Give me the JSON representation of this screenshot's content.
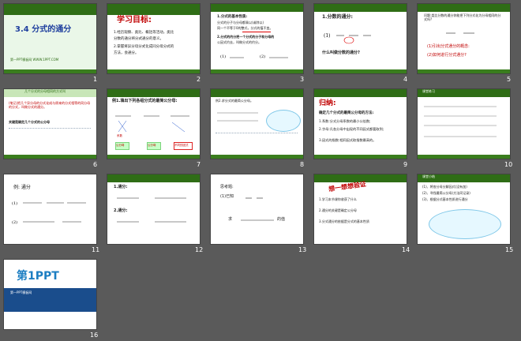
{
  "slides": [
    {
      "num": "1",
      "title": "3.4 分式的通分",
      "footer": "第一PPT模板网 WWW.1PPT.COM"
    },
    {
      "num": "2",
      "title": "学习目标:",
      "lines": [
        "1.经历观察、类比、概括等活动，类比",
        "分数的通分将分式通分的意义。",
        "2.掌握将异分母分式化成同分母分式的",
        "方法，会通分。"
      ]
    },
    {
      "num": "3",
      "lines": [
        "1.分式的基本性质:",
        "分式的分子与分母都乘以(或除以)",
        "同一个不等于0的整式，分式的值不变。",
        "2.分式的约分把一个分式的分子和分母的",
        "公因式约去，叫做分式的约分。"
      ]
    },
    {
      "num": "4",
      "heading": "1.分数的通分:",
      "question": "什么叫做分数的通分?"
    },
    {
      "num": "5",
      "question": "问题:类比分数的通分你能把下列分式化为分母相同的分式吗?",
      "points": [
        "(1)引出分式通分的概念:",
        "(2)如何进行分式通分?"
      ]
    },
    {
      "num": "6",
      "title": "几个分式的分母相同的方式叫",
      "note": "(笔记)把几个异分母的分式化成与原来的分式相等的同分母的分式，叫做分式的通分。",
      "key": "关键是确定几个分式的公分母"
    },
    {
      "num": "7",
      "heading": "例1.填出下列各组分式的最简公分母:",
      "labels": [
        "系数",
        "公分母",
        "公分母",
        "不同的因式"
      ]
    },
    {
      "num": "8",
      "intro": "例2.求分式的最简公分母。"
    },
    {
      "num": "9",
      "heading": "归纳:",
      "subheading": "确定几个分式的最简公分母的方法:",
      "points": [
        "1.系数:分式分母系数的最小公倍数;",
        "2.字母:凡各分母中出现的不同因式都要取到;",
        "3.因式的指数:相同因式取指数最高的。"
      ]
    },
    {
      "num": "10",
      "heading": "课堂练习"
    },
    {
      "num": "11",
      "heading": "例: 通分"
    },
    {
      "num": "12",
      "headings": [
        "1.通分:",
        "2.通分:"
      ]
    },
    {
      "num": "13",
      "lines": [
        "思考题:",
        "(1)已知",
        "求",
        "的值"
      ]
    },
    {
      "num": "14",
      "heading": "想一想想验证",
      "points": [
        "1.学习本节课你收获了什么",
        "2.通分的关键是确定公分母",
        "3.分式通分的依据是分式的基本性质"
      ]
    },
    {
      "num": "15",
      "heading": "课堂小结",
      "points": [
        "(1)、将各分母分解因式(没有加)",
        "(2)、寻找最简公分母(方法同记录)",
        "(3)、根据分式基本性质进行通分"
      ]
    },
    {
      "num": "16",
      "logo": "第1PPT",
      "caption": "第一PPT模板网"
    }
  ]
}
